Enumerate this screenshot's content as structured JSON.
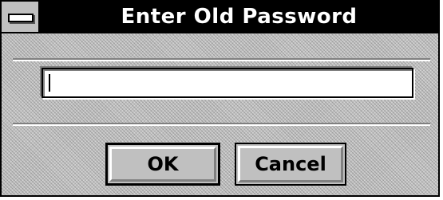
{
  "dialog": {
    "title": "Enter Old Password",
    "password_value": "",
    "ok_label": "OK",
    "cancel_label": "Cancel"
  },
  "icons": {
    "system_menu": "system-menu-icon"
  }
}
